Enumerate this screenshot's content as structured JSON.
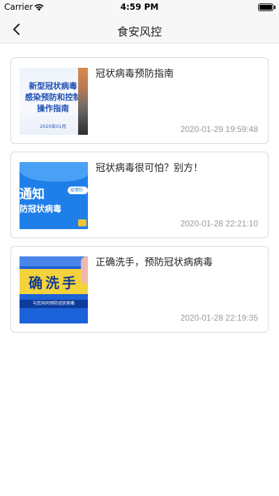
{
  "status": {
    "carrier": "Carrier",
    "time": "4:59 PM"
  },
  "nav": {
    "title": "食安风控"
  },
  "articles": [
    {
      "title": "冠状病毒预防指南",
      "date": "2020-01-29 19:59:48",
      "thumb": {
        "lines": [
          "新型冠状病毒",
          "感染预防和控制",
          "操作指南"
        ],
        "date": "2020年01月"
      }
    },
    {
      "title": "冠状病毒很可怕？别方！",
      "date": "2020-01-28 22:21:10",
      "thumb": {
        "big": "通知",
        "small": "防冠状病毒",
        "pill": "疫情防控"
      }
    },
    {
      "title": "正确洗手，预防冠状病病毒",
      "date": "2020-01-28 22:19:35",
      "thumb": {
        "big": "确洗手",
        "sub": "与您共同预防冠状病毒"
      }
    }
  ]
}
